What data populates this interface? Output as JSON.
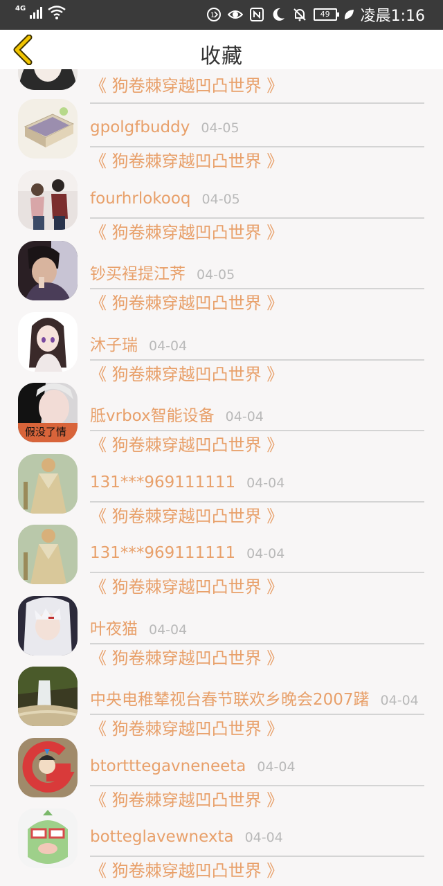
{
  "status_bar": {
    "network": "4G",
    "battery": "49",
    "time": "凌晨1:16"
  },
  "header": {
    "title": "收藏"
  },
  "colors": {
    "accent": "#e8a06a",
    "date": "#b9b9b9",
    "divider": "#d4d4d4",
    "back_icon": "#e7b400"
  },
  "favorites": [
    {
      "name": "",
      "date": "",
      "book": "《 狗卷棘穿越凹凸世界 》",
      "avatar": "ink-portrait"
    },
    {
      "name": "gpolgfbuddy",
      "date": "04-05",
      "book": "《 狗卷棘穿越凹凸世界 》",
      "avatar": "noodles"
    },
    {
      "name": "fourhrlokooq",
      "date": "04-05",
      "book": "《 狗卷棘穿越凹凸世界 》",
      "avatar": "couple"
    },
    {
      "name": "钞买裎提江荠",
      "date": "04-05",
      "book": "《 狗卷棘穿越凹凸世界 》",
      "avatar": "boy"
    },
    {
      "name": "沐子瑞",
      "date": "04-04",
      "book": "《 狗卷棘穿越凹凸世界 》",
      "avatar": "anime-girl"
    },
    {
      "name": "胝vrbox智能设备",
      "date": "04-04",
      "book": "《 狗卷棘穿越凹凸世界 》",
      "avatar": "girl-text"
    },
    {
      "name": "131***969111111",
      "date": "04-04",
      "book": "《 狗卷棘穿越凹凸世界 》",
      "avatar": "warrior"
    },
    {
      "name": "131***969111111",
      "date": "04-04",
      "book": "《 狗卷棘穿越凹凸世界 》",
      "avatar": "warrior"
    },
    {
      "name": "叶夜猫",
      "date": "04-04",
      "book": "《 狗卷棘穿越凹凸世界 》",
      "avatar": "anime-white"
    },
    {
      "name": "中央电稚辇视台春节联欢乡晚会2007躇",
      "date": "04-04",
      "book": "《 狗卷棘穿越凹凸世界 》",
      "avatar": "waterfall"
    },
    {
      "name": "btortttegavneneeta",
      "date": "04-04",
      "book": "《 狗卷棘穿越凹凸世界 》",
      "avatar": "letter-g"
    },
    {
      "name": "botteglavewnexta",
      "date": "04-04",
      "book": "《 狗卷棘穿越凹凸世界 》",
      "avatar": "cartoon-green"
    }
  ],
  "avatar_text": {
    "girl-text": "假没了情"
  }
}
